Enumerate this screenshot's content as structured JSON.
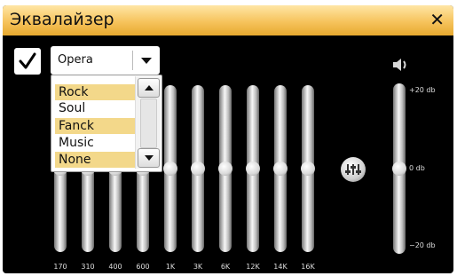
{
  "window": {
    "title": "Эквалайзер"
  },
  "preset": {
    "enabled": true,
    "selected": "Opera",
    "options": [
      {
        "label": "Rock",
        "selected": true
      },
      {
        "label": "Soul",
        "selected": false
      },
      {
        "label": "Fanck",
        "selected": true
      },
      {
        "label": "Music",
        "selected": false
      },
      {
        "label": "None",
        "selected": true
      }
    ]
  },
  "equalizer": {
    "bands": [
      {
        "label": "170",
        "level": 0
      },
      {
        "label": "310",
        "level": 0
      },
      {
        "label": "400",
        "level": 0
      },
      {
        "label": "600",
        "level": 0
      },
      {
        "label": "1K",
        "level": 0
      },
      {
        "label": "3K",
        "level": 0
      },
      {
        "label": "6K",
        "level": 0
      },
      {
        "label": "12K",
        "level": 0
      },
      {
        "label": "14K",
        "level": 0
      },
      {
        "label": "16K",
        "level": 0
      }
    ]
  },
  "volume": {
    "max_label": "+20 db",
    "mid_label": "0 db",
    "min_label": "−20 db",
    "level": 0
  },
  "icons": {
    "close": "close-icon",
    "check": "check-icon",
    "dropdown": "chevron-down-icon",
    "scroll_up": "scroll-up-icon",
    "scroll_down": "scroll-down-icon",
    "reset": "equalizer-reset-icon",
    "speaker": "speaker-icon"
  }
}
